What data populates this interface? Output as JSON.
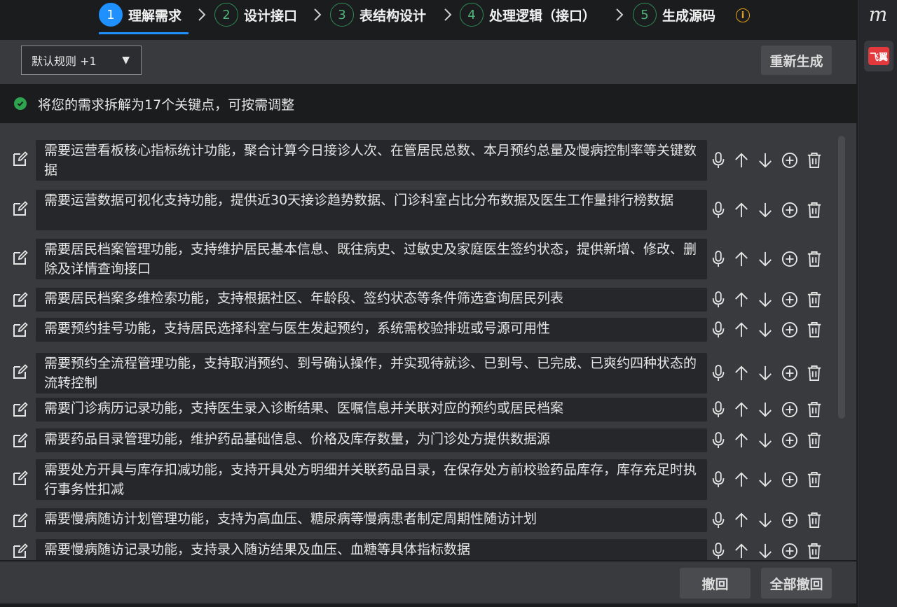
{
  "steps": [
    {
      "num": "1",
      "label": "理解需求",
      "active": true
    },
    {
      "num": "2",
      "label": "设计接口",
      "active": false
    },
    {
      "num": "3",
      "label": "表结构设计",
      "active": false
    },
    {
      "num": "4",
      "label": "处理逻辑（接口）",
      "active": false
    },
    {
      "num": "5",
      "label": "生成源码",
      "active": false
    }
  ],
  "info_icon": "i",
  "toolbar": {
    "select_value": "默认规则 +1",
    "select_caret": "▼",
    "regenerate_label": "重新生成"
  },
  "notice": "将您的需求拆解为17个关键点，可按需调整",
  "requirements": [
    "需要运营看板核心指标统计功能，聚合计算今日接诊人次、在管居民总数、本月预约总量及慢病控制率等关键数据",
    "需要运营数据可视化支持功能，提供近30天接诊趋势数据、门诊科室占比分布数据及医生工作量排行榜数据",
    "需要居民档案管理功能，支持维护居民基本信息、既往病史、过敏史及家庭医生签约状态，提供新增、修改、删除及详情查询接口",
    "需要居民档案多维检索功能，支持根据社区、年龄段、签约状态等条件筛选查询居民列表",
    "需要预约挂号功能，支持居民选择科室与医生发起预约，系统需校验排班或号源可用性",
    "需要预约全流程管理功能，支持取消预约、到号确认操作，并实现待就诊、已到号、已完成、已爽约四种状态的流转控制",
    "需要门诊病历记录功能，支持医生录入诊断结果、医嘱信息并关联对应的预约或居民档案",
    "需要药品目录管理功能，维护药品基础信息、价格及库存数量，为门诊处方提供数据源",
    "需要处方开具与库存扣减功能，支持开具处方明细并关联药品目录，在保存处方前校验药品库存，库存充足时执行事务性扣减",
    "需要慢病随访计划管理功能，支持为高血压、糖尿病等慢病患者制定周期性随访计划",
    "需要慢病随访记录功能，支持录入随访结果及血压、血糖等具体指标数据"
  ],
  "bottom": {
    "undo_label": "撤回",
    "undo_all_label": "全部撤回"
  },
  "rightbar": {
    "logo": "m",
    "badge": "飞翼"
  },
  "colors": {
    "accent": "#1e90ff",
    "success": "#2ea44f",
    "warning": "#e8a317",
    "badge": "#e4393c"
  }
}
